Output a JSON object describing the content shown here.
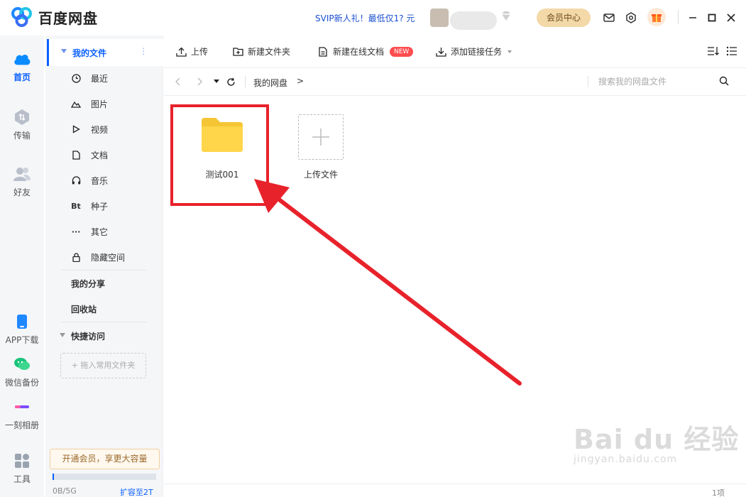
{
  "app": {
    "name": "百度网盘",
    "svip_promo": "SVIP新人礼！最低仅1? 元",
    "vip_button": "会员中心"
  },
  "rail": [
    {
      "label": "首页",
      "icon": "cloud-icon",
      "active": true
    },
    {
      "label": "传输",
      "icon": "transfer-icon"
    },
    {
      "label": "好友",
      "icon": "friends-icon"
    },
    {
      "label": "APP下载",
      "icon": "phone-icon"
    },
    {
      "label": "微信备份",
      "icon": "wechat-icon"
    },
    {
      "label": "一刻相册",
      "icon": "album-icon"
    },
    {
      "label": "工具",
      "icon": "tools-icon"
    }
  ],
  "nav": {
    "my_files": "我的文件",
    "more": "⋮",
    "items": [
      {
        "label": "最近",
        "icon": "clock-icon"
      },
      {
        "label": "图片",
        "icon": "image-icon"
      },
      {
        "label": "视频",
        "icon": "video-icon"
      },
      {
        "label": "文档",
        "icon": "document-icon"
      },
      {
        "label": "音乐",
        "icon": "music-icon"
      },
      {
        "label": "种子",
        "icon": "bt-icon",
        "glyph": "Bt"
      },
      {
        "label": "其它",
        "icon": "more-icon",
        "glyph": "···"
      },
      {
        "label": "隐藏空间",
        "icon": "lock-icon"
      }
    ],
    "my_share": "我的分享",
    "recycle": "回收站",
    "quick_access": "快捷访问",
    "drag_hint": "+ 拖入常用文件夹",
    "promo": "开通会员，享更大容量",
    "quota": "0B/5G",
    "expand": "扩容至2T",
    "quota_used_fraction": 0.01
  },
  "toolbar": {
    "upload": "上传",
    "new_folder": "新建文件夹",
    "new_online_doc": "新建在线文档",
    "new_badge": "NEW",
    "add_link_task": "添加链接任务"
  },
  "breadcrumb": {
    "root": "我的网盘",
    "arrow": ">",
    "search_placeholder": "搜索我的网盘文件"
  },
  "files": [
    {
      "name": "测试001",
      "type": "folder"
    },
    {
      "name": "上传文件",
      "type": "upload"
    }
  ],
  "status": {
    "count": "1项"
  },
  "watermark": {
    "brand": "Bai du 经验",
    "url": "jingyan.baidu.com"
  },
  "colors": {
    "accent": "#0a5fff",
    "highlight": "#e8222b",
    "folder": "#ffd54a"
  }
}
